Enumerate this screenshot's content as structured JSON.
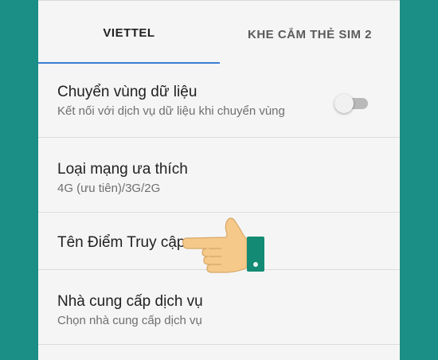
{
  "tabs": [
    {
      "label": "VIETTEL",
      "selected": true
    },
    {
      "label": "KHE CẮM THẺ SIM 2",
      "selected": false
    }
  ],
  "settings": [
    {
      "title": "Chuyển vùng dữ liệu",
      "subtitle": "Kết nối với dịch vụ dữ liệu khi chuyển vùng",
      "toggle": "off"
    },
    {
      "title": "Loại mạng ưa thích",
      "subtitle": "4G (ưu tiên)/3G/2G"
    },
    {
      "title": "Tên Điểm Truy cập"
    },
    {
      "title": "Nhà cung cấp dịch vụ",
      "subtitle": "Chọn nhà cung cấp dịch vụ"
    }
  ],
  "pointer": {
    "icon": "pointing-hand-icon",
    "target": "Tên Điểm Truy cập"
  },
  "colors": {
    "background": "#1b8e86",
    "tab_indicator": "#3b7fd4",
    "panel": "#f5f5f5"
  }
}
